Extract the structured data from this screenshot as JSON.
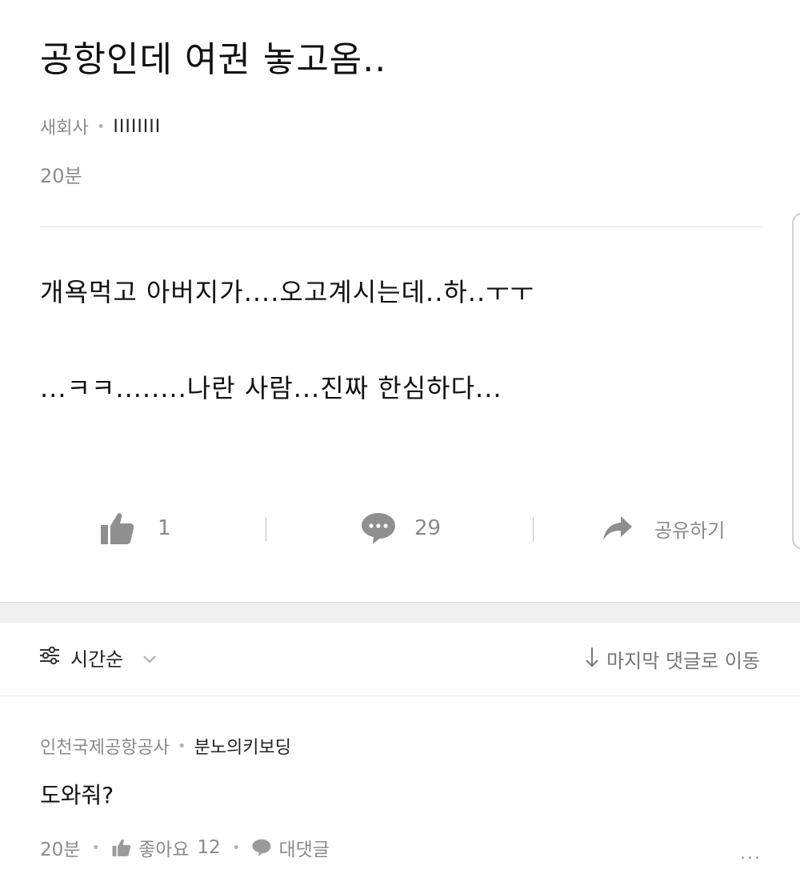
{
  "post": {
    "title": "공항인데 여권 놓고옴..",
    "board": "새회사",
    "author": "IIIIIIII",
    "time": "20분",
    "body_lines": [
      "개욕먹고 아버지가....오고계시는데..하..ㅜㅜ",
      "...ㅋㅋ........나란 사람...진짜 한심하다..."
    ],
    "actions": {
      "like_icon": "thumbs-up-icon",
      "like_count": "1",
      "comment_icon": "speech-bubble-icon",
      "comment_count": "29",
      "share_icon": "share-arrow-icon",
      "share_label": "공유하기"
    }
  },
  "sort": {
    "icon": "sort-filter-icon",
    "label": "시간순",
    "chevron_icon": "chevron-down-icon",
    "jump_icon": "down-arrow-icon",
    "jump_label": "마지막 댓글로 이동"
  },
  "comment": {
    "company": "인천국제공항공사",
    "author": "분노의키보딩",
    "text": "도와줘?",
    "time": "20분",
    "like_label": "좋아요",
    "like_count": "12",
    "reply_label": "대댓글",
    "more_icon": "more-dots-icon",
    "more_text": "..."
  },
  "colors": {
    "text": "#111111",
    "muted": "#8a8a8a",
    "divider": "#e2e2e2",
    "band": "#f0f0f0"
  }
}
